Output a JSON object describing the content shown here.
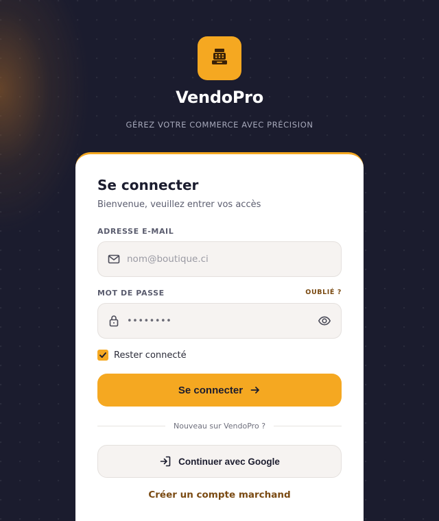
{
  "brand": {
    "name": "VendoPro",
    "tagline": "GÉREZ VOTRE COMMERCE AVEC PRÉCISION",
    "logo_icon": "cash-register-icon",
    "accent_color": "#f5a821"
  },
  "login": {
    "title": "Se connecter",
    "subtitle": "Bienvenue, veuillez entrer vos accès",
    "email_label": "ADRESSE E-MAIL",
    "email_placeholder": "nom@boutique.ci",
    "email_value": "",
    "password_label": "MOT DE PASSE",
    "forgot_label": "OUBLIÉ ?",
    "password_masked": "••••••••",
    "remember_label": "Rester connecté",
    "remember_checked": true,
    "submit_label": "Se connecter",
    "divider_text": "Nouveau sur VendoPro ?",
    "google_label": "Continuer avec Google",
    "create_account_label": "Créer un compte marchand"
  },
  "colors": {
    "background": "#1b1c2e",
    "accent": "#f5a821",
    "link": "#7a4a12",
    "card": "#ffffff"
  }
}
